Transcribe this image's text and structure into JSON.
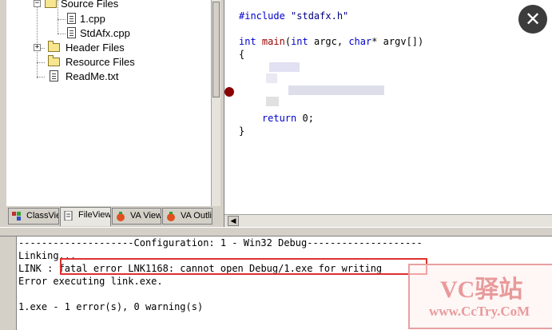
{
  "workspace_tree": {
    "items": [
      {
        "label": "Source Files"
      },
      {
        "label": "1.cpp"
      },
      {
        "label": "StdAfx.cpp"
      },
      {
        "label": "Header Files"
      },
      {
        "label": "Resource Files"
      },
      {
        "label": "ReadMe.txt"
      }
    ]
  },
  "tabs": [
    {
      "label": "ClassView"
    },
    {
      "label": "FileView"
    },
    {
      "label": "VA View"
    },
    {
      "label": "VA Outline"
    }
  ],
  "editor": {
    "lines": {
      "include_kw": "#include",
      "include_str": "\"stdafx.h\"",
      "int1": "int",
      "main": "main",
      "params_open": "(",
      "int2": "int",
      "argc": " argc, ",
      "char_kw": "char",
      "argv": "* argv[])",
      "brace_open": "{",
      "return_kw": "return",
      "return_val": " 0;",
      "brace_close": "}"
    }
  },
  "output": {
    "config_line": "--------------------Configuration: 1 - Win32 Debug--------------------",
    "linking": "Linking...",
    "link_prefix": "LINK : ",
    "error_text": "fatal error LNK1168: cannot open Debug/1.exe for writing",
    "executing": "Error executing link.exe.",
    "summary": "1.exe - 1 error(s), 0 warning(s)"
  },
  "watermark": {
    "title": "VC驿站",
    "url": "www.CcTry.CoM"
  },
  "close_icon": "close-icon",
  "colors": {
    "keyword": "#0000cc",
    "function": "#990000",
    "breakpoint": "#8b0000",
    "error_box": "#e03030"
  }
}
